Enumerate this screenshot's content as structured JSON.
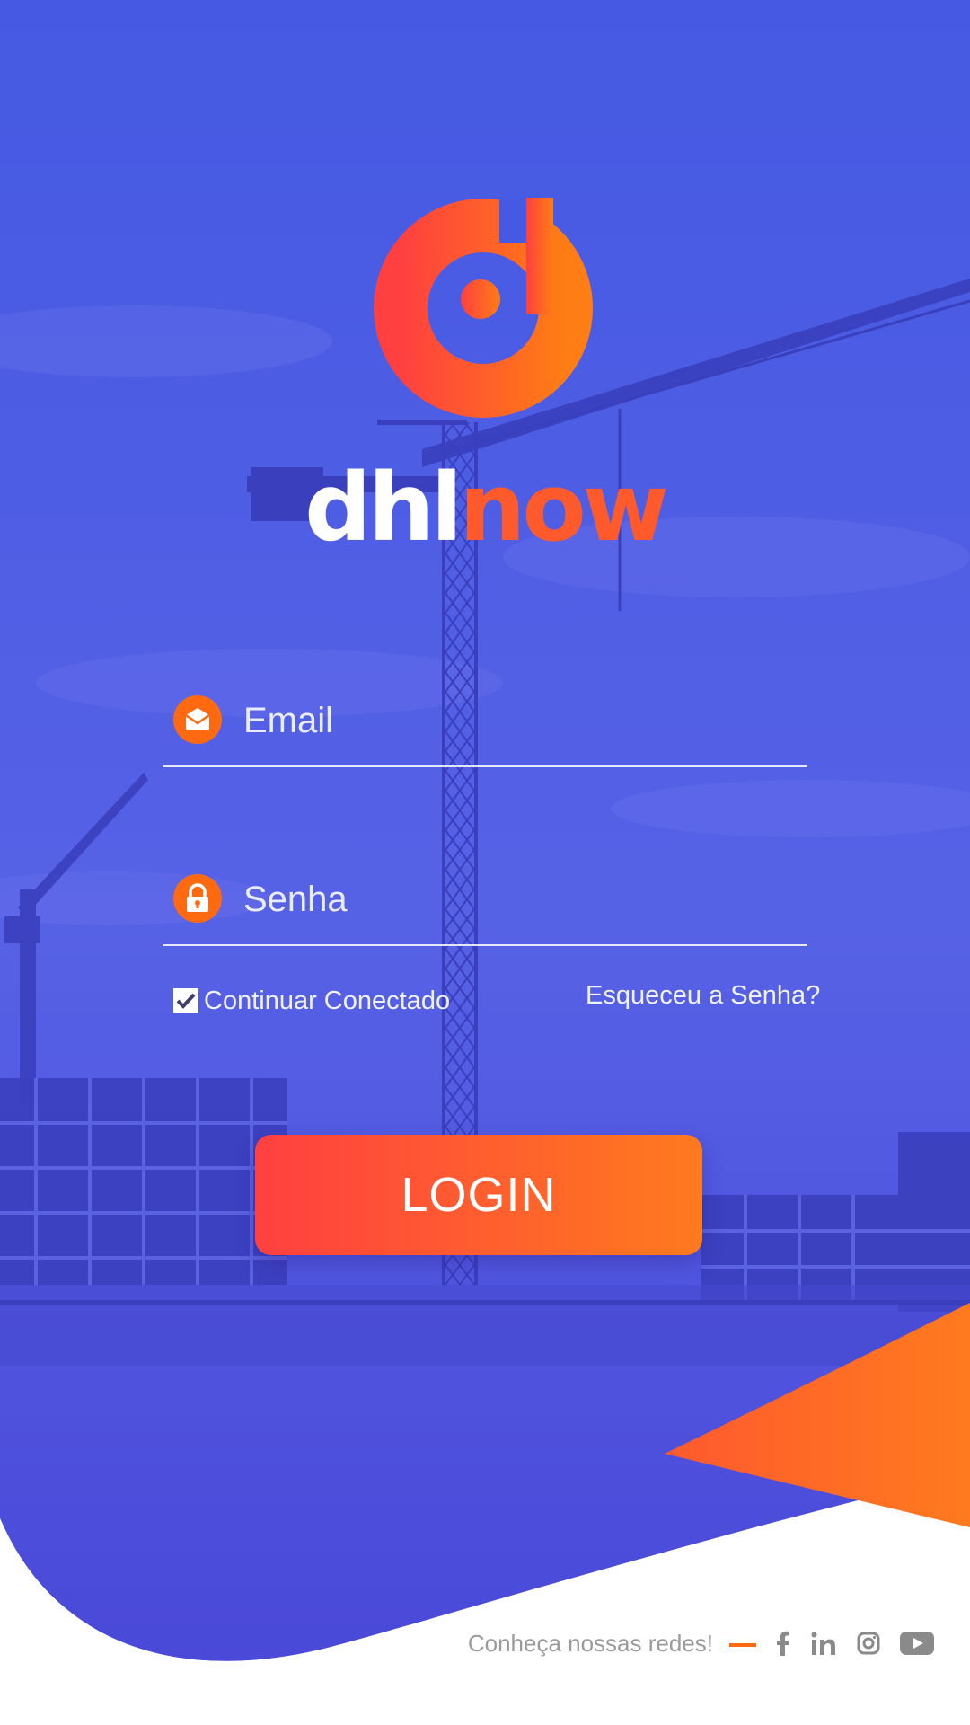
{
  "brand": {
    "name_part1": "dhl",
    "name_part2": "now"
  },
  "form": {
    "email_placeholder": "Email",
    "password_placeholder": "Senha",
    "remember_label": "Continuar Conectado",
    "remember_checked": true,
    "forgot_label": "Esqueceu a Senha?",
    "login_label": "LOGIN"
  },
  "footer": {
    "caption": "Conheça nossas redes!",
    "socials": [
      "facebook-icon",
      "linkedin-icon",
      "instagram-icon",
      "youtube-icon"
    ]
  },
  "colors": {
    "primary_blue": "#4a55e2",
    "accent_orange": "#ff7a1e",
    "accent_red": "#ff4040"
  }
}
